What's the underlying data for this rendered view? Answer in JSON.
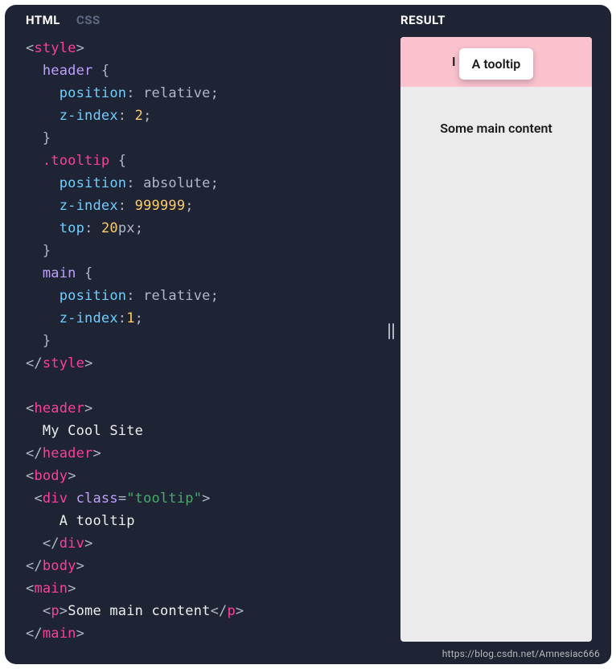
{
  "tabs": {
    "html": "HTML",
    "css": "CSS"
  },
  "resultLabel": "RESULT",
  "code": {
    "t_style": "style",
    "sel_header": "header",
    "sel_tooltip": ".tooltip",
    "sel_main": "main",
    "brace_open": " {",
    "brace_close": "}",
    "p_position": "position",
    "p_zindex": "z-index",
    "p_top": "top",
    "v_relative": "relative",
    "v_absolute": "absolute",
    "n2": "2",
    "n_big": "999999",
    "n20": "20",
    "n1": "1",
    "u_px": "px",
    "t_header": "header",
    "t_body": "body",
    "t_div": "div",
    "t_main": "main",
    "t_p": "p",
    "a_class": "class",
    "s_tooltip": "\"tooltip\"",
    "txt_site": "My Cool Site",
    "txt_tooltip": "A tooltip",
    "txt_main": "Some main content",
    "colon": ":",
    "semi": ";",
    "eq": "=",
    "lt": "<",
    "gt": ">",
    "lts": "</",
    "sp2": "  ",
    "sp4": "    ",
    "sp": " "
  },
  "preview": {
    "headerText": "I",
    "tooltipText": "A tooltip",
    "mainText": "Some main content"
  },
  "watermark": "https://blog.csdn.net/Amnesiac666"
}
